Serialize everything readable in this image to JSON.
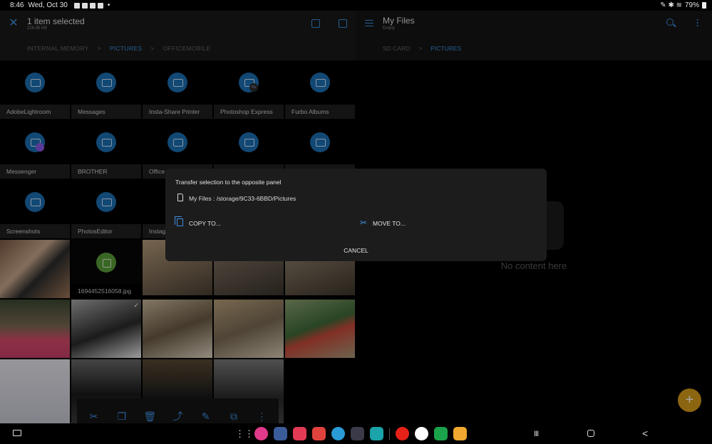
{
  "status": {
    "time": "8:46",
    "date": "Wed, Oct 30",
    "dot": "•",
    "battery": "79%"
  },
  "left_panel": {
    "title": "1 item selected",
    "size": "226.95 KB",
    "breadcrumb": [
      "INTERNAL MEMORY",
      "PICTURES",
      "OFFICEMOBILE"
    ],
    "breadcrumb_sep": ">",
    "folders": [
      {
        "label": "AdobeLightroom"
      },
      {
        "label": "Messages"
      },
      {
        "label": "Insta-Share Printer"
      },
      {
        "label": "Photoshop Express",
        "badge": "Ps"
      },
      {
        "label": "Furbo Albums"
      },
      {
        "label": "Messenger"
      },
      {
        "label": "BROTHER"
      },
      {
        "label": "Office"
      },
      {
        "label": ""
      },
      {
        "label": ""
      },
      {
        "label": "Screenshots"
      },
      {
        "label": "PhotosEditor"
      },
      {
        "label": "Instag"
      }
    ],
    "file_label": "1694452516058.jpg",
    "check": "✓"
  },
  "toolbar": {
    "icons": [
      "cut-icon",
      "copy-icon",
      "delete-icon",
      "share-icon",
      "edit-icon",
      "duplicate-icon",
      "more-icon"
    ],
    "glyphs": [
      "✂",
      "❐",
      "🗑",
      "⤴",
      "✎",
      "⧉",
      "⋮"
    ]
  },
  "right_panel": {
    "title": "My Files",
    "subtitle": "Empty",
    "breadcrumb": [
      "SD CARD",
      "PICTURES"
    ],
    "breadcrumb_sep": ">",
    "empty_text": "No content here",
    "fab": "+"
  },
  "dialog": {
    "title": "Transfer selection to the opposite panel",
    "path": "My Files : /storage/9C33-6BBD/Pictures",
    "copy": "COPY TO...",
    "move": "MOVE TO...",
    "cancel": "CANCEL"
  },
  "nav": {
    "apps": [
      {
        "name": "app-drawer-icon",
        "color": "#000000"
      },
      {
        "name": "blossom-app-icon",
        "color": "#e23a8a"
      },
      {
        "name": "settings-app-icon",
        "color": "#3a5d9a"
      },
      {
        "name": "camera-app-icon",
        "color": "#e23a55"
      },
      {
        "name": "messages-app-icon",
        "color": "#e0433e"
      },
      {
        "name": "edge-browser-icon",
        "color": "#2a9bd6"
      },
      {
        "name": "folder-group-icon",
        "color": "#3a3a48"
      },
      {
        "name": "mail-app-icon",
        "color": "#1aa3a8"
      },
      {
        "name": "youtube-app-icon",
        "color": "#e62117"
      },
      {
        "name": "google-app-icon",
        "color": "#ffffff"
      },
      {
        "name": "td-bank-app-icon",
        "color": "#1aa34a"
      },
      {
        "name": "my-files-app-icon",
        "color": "#f0a830"
      }
    ],
    "recent": "III",
    "back": "<"
  }
}
